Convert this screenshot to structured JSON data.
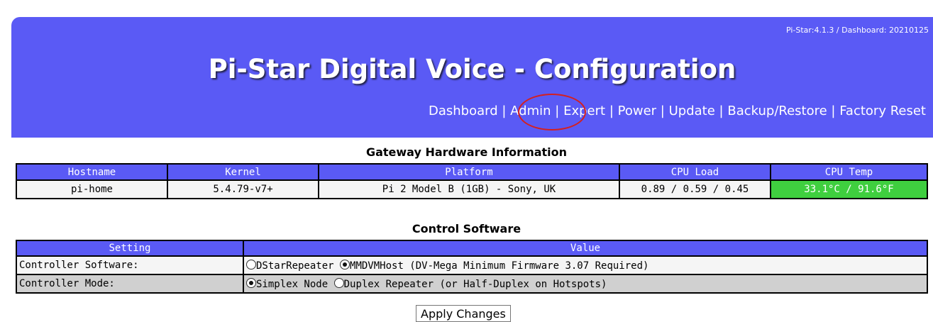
{
  "header": {
    "version": "Pi-Star:4.1.3 / Dashboard: 20210125",
    "title": "Pi-Star Digital Voice - Configuration",
    "nav": [
      "Dashboard",
      "Admin",
      "Expert",
      "Power",
      "Update",
      "Backup/Restore",
      "Factory Reset"
    ],
    "separator": "|"
  },
  "hardware": {
    "title": "Gateway Hardware Information",
    "columns": [
      "Hostname",
      "Kernel",
      "Platform",
      "CPU Load",
      "CPU Temp"
    ],
    "row": [
      "pi-home",
      "5.4.79-v7+",
      "Pi 2 Model B (1GB) - Sony, UK",
      "0.89 / 0.59 / 0.45",
      "33.1°C / 91.6°F"
    ]
  },
  "control": {
    "title": "Control Software",
    "columns": [
      "Setting",
      "Value"
    ],
    "rows": [
      {
        "label": "Controller Software:",
        "options": [
          {
            "text": "DStarRepeater",
            "checked": false
          },
          {
            "text": "MMDVMHost (DV-Mega Minimum Firmware 3.07 Required)",
            "checked": true
          }
        ]
      },
      {
        "label": "Controller Mode:",
        "options": [
          {
            "text": "Simplex Node",
            "checked": true
          },
          {
            "text": "Duplex Repeater (or Half-Duplex on Hotspots)",
            "checked": false
          }
        ]
      }
    ],
    "apply_label": "Apply Changes"
  },
  "colors": {
    "header_bg": "#5a5af5",
    "temp_ok": "#3fcf3f",
    "annotation_circle": "#d42020"
  }
}
